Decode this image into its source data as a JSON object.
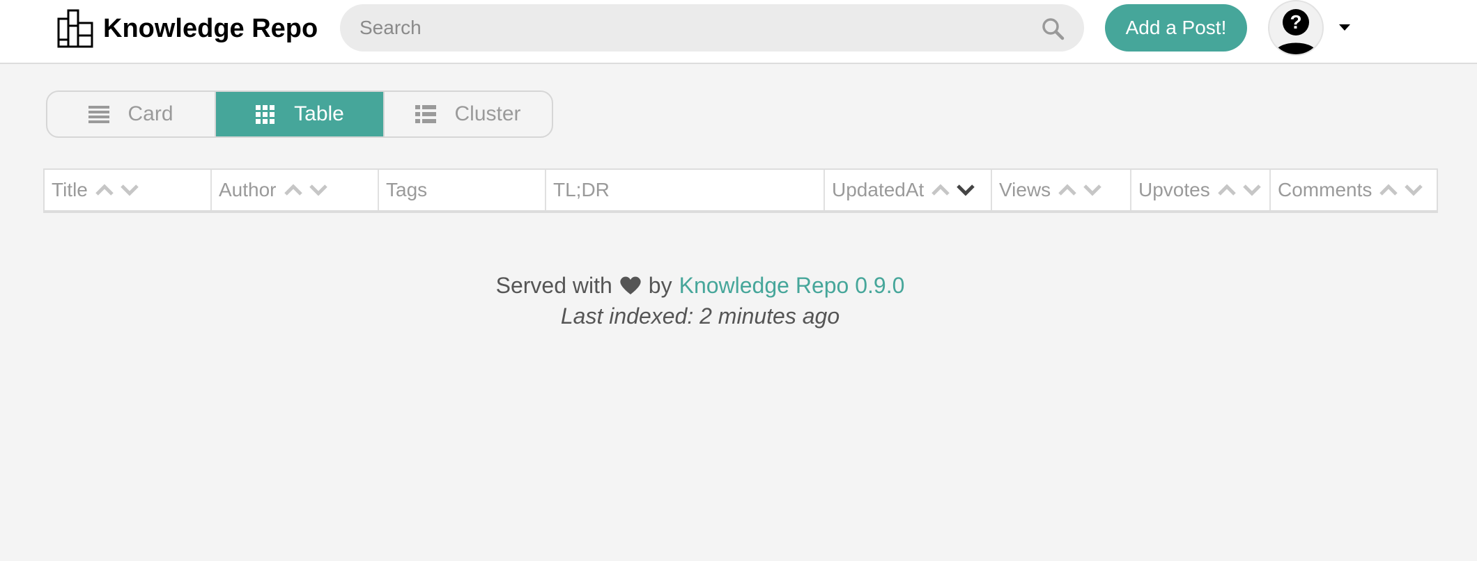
{
  "brand": {
    "name": "Knowledge Repo"
  },
  "search": {
    "placeholder": "Search"
  },
  "header": {
    "add_post_label": "Add a Post!"
  },
  "view_toggle": {
    "card_label": "Card",
    "table_label": "Table",
    "cluster_label": "Cluster",
    "active": "Table"
  },
  "table": {
    "columns": [
      {
        "label": "Title",
        "sortable": true
      },
      {
        "label": "Author",
        "sortable": true
      },
      {
        "label": "Tags",
        "sortable": false
      },
      {
        "label": "TL;DR",
        "sortable": false
      },
      {
        "label": "UpdatedAt",
        "sortable": true,
        "sorted": "desc"
      },
      {
        "label": "Views",
        "sortable": true
      },
      {
        "label": "Upvotes",
        "sortable": true
      },
      {
        "label": "Comments",
        "sortable": true
      }
    ],
    "rows": []
  },
  "footer": {
    "served_with": "Served with",
    "by": "by",
    "link_text": "Knowledge Repo 0.9.0",
    "last_indexed": "Last indexed: 2 minutes ago"
  },
  "colors": {
    "accent": "#46a69a",
    "background": "#f4f4f4"
  }
}
